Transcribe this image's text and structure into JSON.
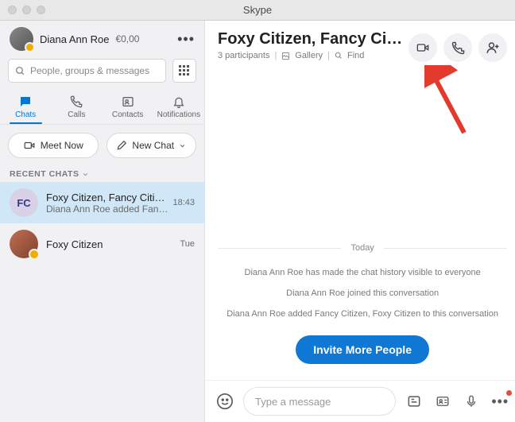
{
  "window": {
    "title": "Skype"
  },
  "profile": {
    "name": "Diana Ann Roe",
    "balance": "€0,00"
  },
  "search": {
    "placeholder": "People, groups & messages"
  },
  "tabs": {
    "chats": "Chats",
    "calls": "Calls",
    "contacts": "Contacts",
    "notifications": "Notifications"
  },
  "actions": {
    "meet_now": "Meet Now",
    "new_chat": "New Chat"
  },
  "sections": {
    "recent": "RECENT CHATS"
  },
  "recent": [
    {
      "title": "Foxy Citizen, Fancy Citizen",
      "preview": "Diana Ann Roe added Fancy …",
      "time": "18:43",
      "initials": "FC"
    },
    {
      "title": "Foxy Citizen",
      "preview": "",
      "time": "Tue"
    }
  ],
  "conversation": {
    "title": "Foxy Citizen, Fancy Ci…",
    "participants_label": "3 participants",
    "gallery_label": "Gallery",
    "find_label": "Find",
    "day": "Today",
    "system_messages": [
      "Diana Ann Roe has made the chat history visible to everyone",
      "Diana Ann Roe joined this conversation",
      "Diana Ann Roe added Fancy Citizen, Foxy Citizen to this conversation"
    ],
    "invite_label": "Invite More People"
  },
  "composer": {
    "placeholder": "Type a message"
  }
}
